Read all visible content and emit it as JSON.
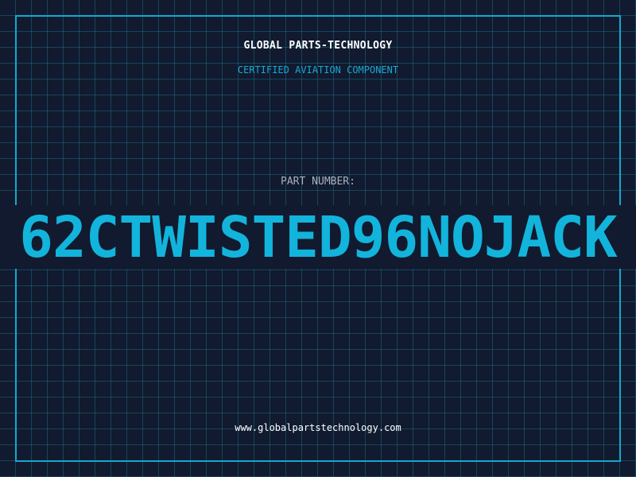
{
  "header": {
    "company": "GLOBAL PARTS-TECHNOLOGY",
    "subtitle": "CERTIFIED AVIATION COMPONENT"
  },
  "part": {
    "label": "PART NUMBER:",
    "number": "62CTWISTED96NOJACK"
  },
  "footer": {
    "website": "www.globalpartstechnology.com"
  },
  "colors": {
    "background": "#111a2e",
    "grid": "#1e7896",
    "accent": "#12b4dc",
    "text": "#ffffff",
    "label": "#aab2c0"
  }
}
